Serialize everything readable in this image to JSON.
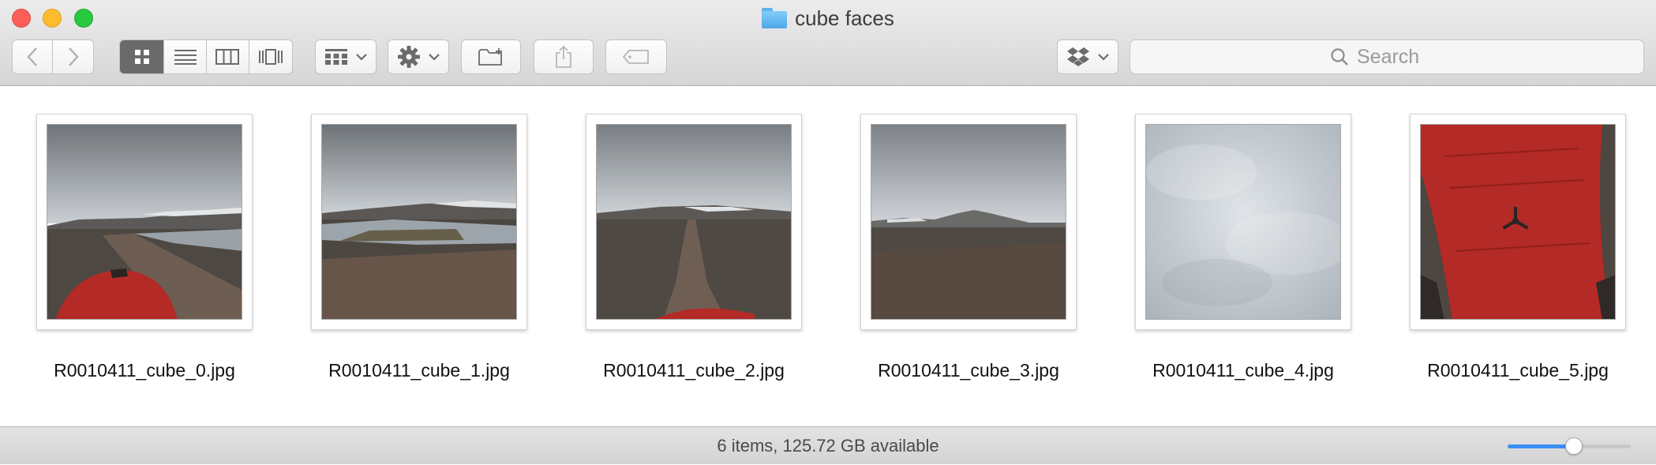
{
  "window": {
    "title": "cube faces"
  },
  "toolbar": {
    "back_icon": "chevron-left-icon",
    "forward_icon": "chevron-right-icon",
    "view_modes": [
      "icon-view-icon",
      "list-view-icon",
      "column-view-icon",
      "coverflow-view-icon"
    ],
    "active_view": "icon",
    "group_icon": "group-grid-icon",
    "action_icon": "gear-icon",
    "new_folder_icon": "new-folder-icon",
    "share_icon": "share-icon",
    "tag_icon": "tag-icon",
    "dropbox_icon": "dropbox-icon"
  },
  "search": {
    "placeholder": "Search"
  },
  "files": [
    {
      "name": "R0010411_cube_0.jpg",
      "thumb": "road-hood"
    },
    {
      "name": "R0010411_cube_1.jpg",
      "thumb": "lake-road"
    },
    {
      "name": "R0010411_cube_2.jpg",
      "thumb": "track-hood"
    },
    {
      "name": "R0010411_cube_3.jpg",
      "thumb": "plain"
    },
    {
      "name": "R0010411_cube_4.jpg",
      "thumb": "sky"
    },
    {
      "name": "R0010411_cube_5.jpg",
      "thumb": "roof"
    }
  ],
  "status": {
    "text": "6 items, 125.72 GB available"
  },
  "icon_size_slider": {
    "value": 0.54
  },
  "colors": {
    "accent": "#3b8ff4",
    "close": "#fc5f57",
    "minimize": "#fdbc2e",
    "maximize": "#28c840",
    "car_red": "#b42a26"
  }
}
